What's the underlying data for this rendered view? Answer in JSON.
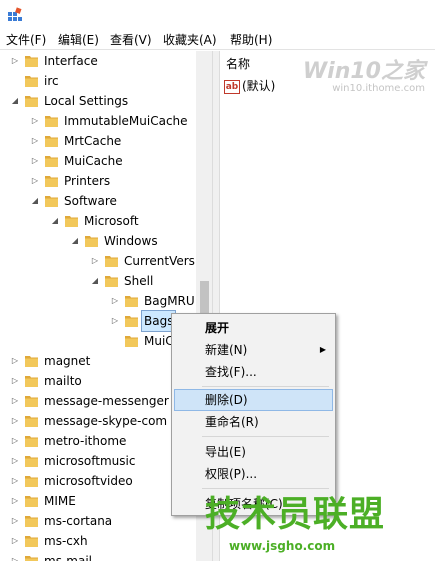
{
  "menubar": {
    "items": [
      "文件(F)",
      "编辑(E)",
      "查看(V)",
      "收藏夹(A)",
      "帮助(H)"
    ]
  },
  "tree": {
    "items": [
      {
        "label": "Interface",
        "expanded": false
      },
      {
        "label": "irc",
        "expanded": null
      },
      {
        "label": "Local Settings",
        "expanded": true
      },
      {
        "label": "ImmutableMuiCache",
        "expanded": false
      },
      {
        "label": "MrtCache",
        "expanded": false
      },
      {
        "label": "MuiCache",
        "expanded": false
      },
      {
        "label": "Printers",
        "expanded": false
      },
      {
        "label": "Software",
        "expanded": true
      },
      {
        "label": "Microsoft",
        "expanded": true
      },
      {
        "label": "Windows",
        "expanded": true
      },
      {
        "label": "CurrentVersio",
        "expanded": false
      },
      {
        "label": "Shell",
        "expanded": true
      },
      {
        "label": "BagMRU",
        "expanded": false
      },
      {
        "label": "Bags",
        "expanded": false,
        "selected": true
      },
      {
        "label": "MuiC",
        "expanded": null
      },
      {
        "label": "magnet",
        "expanded": false
      },
      {
        "label": "mailto",
        "expanded": false
      },
      {
        "label": "message-messenger",
        "expanded": false
      },
      {
        "label": "message-skype-com",
        "expanded": false
      },
      {
        "label": "metro-ithome",
        "expanded": false
      },
      {
        "label": "microsoftmusic",
        "expanded": false
      },
      {
        "label": "microsoftvideo",
        "expanded": false
      },
      {
        "label": "MIME",
        "expanded": false
      },
      {
        "label": "ms-cortana",
        "expanded": false
      },
      {
        "label": "ms-cxh",
        "expanded": false
      },
      {
        "label": "ms-mail",
        "expanded": false
      }
    ]
  },
  "values_pane": {
    "column_name": "名称",
    "default_value": "(默认)",
    "ab_icon_text": "ab"
  },
  "watermark_top": {
    "brand": "Win10之家",
    "url": "win10.ithome.com"
  },
  "context_menu": {
    "expand": "展开",
    "new": "新建(N)",
    "find": "查找(F)...",
    "delete": "删除(D)",
    "rename": "重命名(R)",
    "export": "导出(E)",
    "permissions": "权限(P)...",
    "copy_key_name": "复制项名称(C)"
  },
  "watermark_bottom": {
    "brand": "技术员联盟",
    "url": "www.jsgho.com"
  },
  "colors": {
    "folder": "#f2c85b",
    "selection": "#cce8ff",
    "hover": "#cfe4f8",
    "watermark_green": "#4caf26"
  }
}
